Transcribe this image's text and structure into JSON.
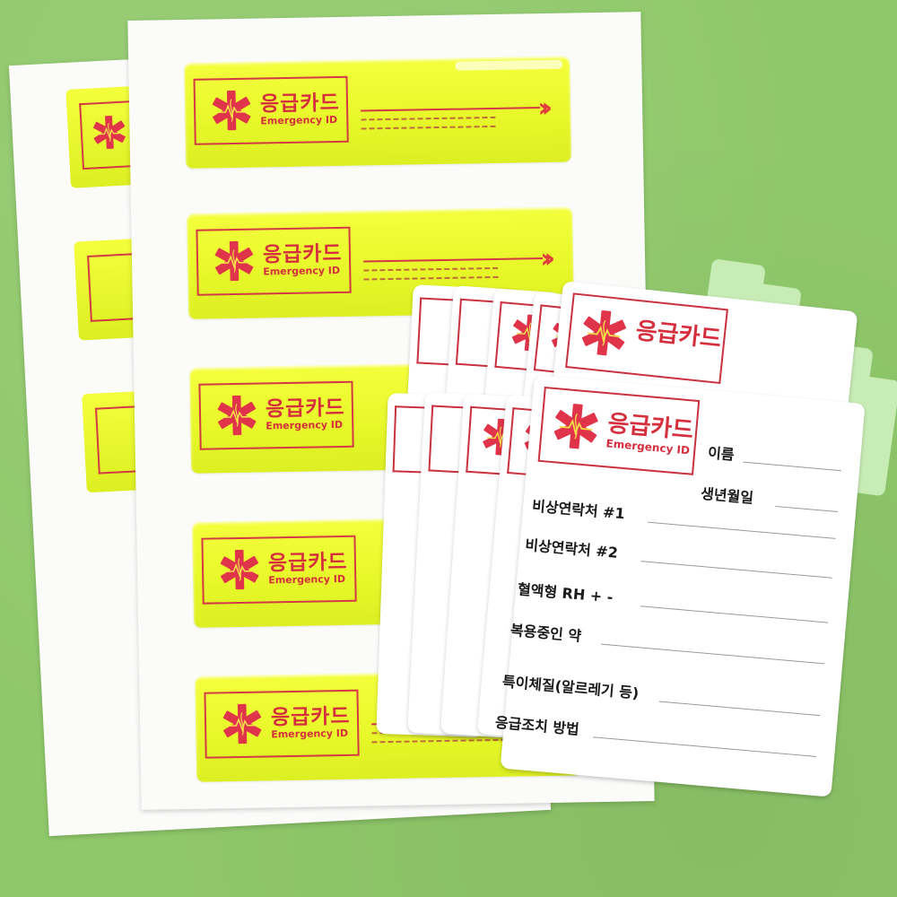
{
  "scene": {
    "sticker_title_ko": "응급카드",
    "sticker_title_en": "Emergency ID",
    "card_title_ko": "응급카드",
    "card_title_en": "Emergency ID",
    "fields": [
      {
        "label": "이름"
      },
      {
        "label": "생년월일"
      },
      {
        "label": "비상연락처 #1"
      },
      {
        "label": "비상연락처 #2"
      },
      {
        "label": "혈액형  RH  +  -"
      },
      {
        "label": "복용중인 약"
      },
      {
        "label": "특이체질(알르레기 등)"
      },
      {
        "label": "응급조치 방법"
      }
    ],
    "colors": {
      "background": "#8fc86a",
      "sticker_yellow": "#ecfa2e",
      "accent_red": "#d52f3e",
      "tab_green": "#c8ecb6"
    },
    "icons": [
      "medical-star-of-life-icon",
      "chevron-double-right-icon"
    ]
  }
}
